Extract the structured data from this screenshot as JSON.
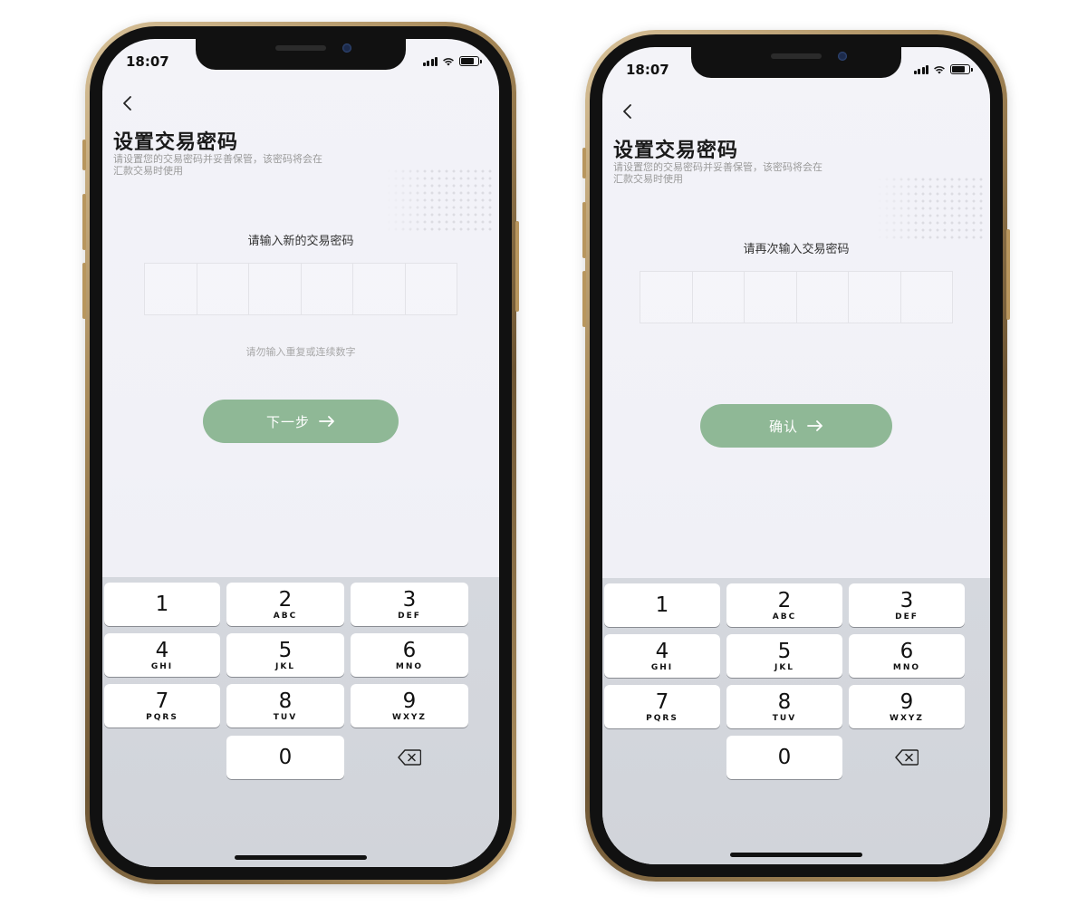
{
  "phones": [
    {
      "status": {
        "time": "18:07"
      },
      "title": "设置交易密码",
      "subtitle": "请设置您的交易密码并妥善保管，该密码将会在汇款交易时使用",
      "prompt": "请输入新的交易密码",
      "hint": "请勿输入重复或连续数字",
      "action_label": "下一步"
    },
    {
      "status": {
        "time": "18:07"
      },
      "title": "设置交易密码",
      "subtitle": "请设置您的交易密码并妥善保管，该密码将会在汇款交易时使用",
      "prompt": "请再次输入交易密码",
      "hint": "",
      "action_label": "确认"
    }
  ],
  "keypad": [
    {
      "num": "1",
      "letters": ""
    },
    {
      "num": "2",
      "letters": "ABC"
    },
    {
      "num": "3",
      "letters": "DEF"
    },
    {
      "num": "4",
      "letters": "GHI"
    },
    {
      "num": "5",
      "letters": "JKL"
    },
    {
      "num": "6",
      "letters": "MNO"
    },
    {
      "num": "7",
      "letters": "PQRS"
    },
    {
      "num": "8",
      "letters": "TUV"
    },
    {
      "num": "9",
      "letters": "WXYZ"
    },
    {
      "num": "0",
      "letters": ""
    }
  ],
  "icons": {
    "back": "chevron-left-icon",
    "arrow": "arrow-right-icon",
    "delete": "backspace-icon",
    "signal": "cellular-signal-icon",
    "wifi": "wifi-icon",
    "battery": "battery-icon"
  },
  "colors": {
    "accent": "#8fb896",
    "keyboard_bg": "#d3d6dc",
    "title": "#1a1a1a"
  }
}
